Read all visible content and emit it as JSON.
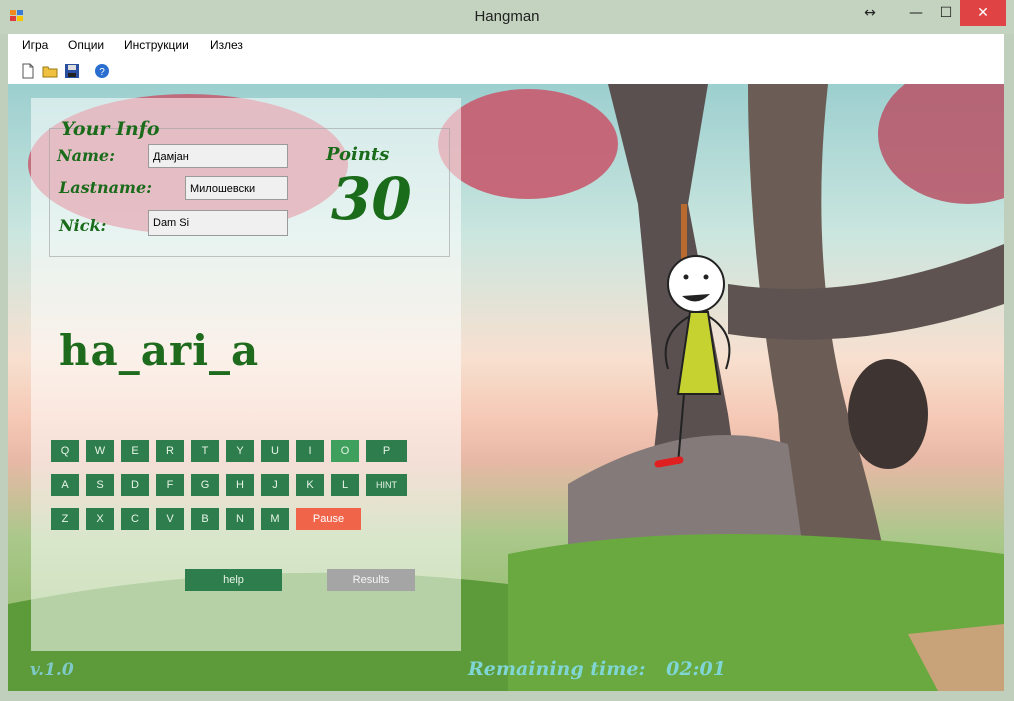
{
  "window": {
    "title": "Hangman",
    "controls": {
      "resize": "↔",
      "minimize": "—",
      "maximize": "☐",
      "close": "✕"
    }
  },
  "menu": [
    "Игра",
    "Опции",
    "Инструкции",
    "Излез"
  ],
  "toolbar": {
    "icons": [
      "new-file-icon",
      "open-folder-icon",
      "save-icon",
      "help-icon"
    ]
  },
  "info": {
    "title": "Your Info",
    "name_label": "Name:",
    "lastname_label": "Lastname:",
    "nick_label": "Nick:",
    "name": "Дамјан",
    "lastname": "Милошевски",
    "nick": "Dam Si"
  },
  "points": {
    "label": "Points",
    "value": "30"
  },
  "word": "ha_ari_a",
  "keyboard": {
    "row1": [
      "Q",
      "W",
      "E",
      "R",
      "T",
      "Y",
      "U",
      "I",
      "O",
      "P"
    ],
    "row2": [
      "A",
      "S",
      "D",
      "F",
      "G",
      "H",
      "J",
      "K",
      "L",
      "HINT"
    ],
    "row3": [
      "Z",
      "X",
      "C",
      "V",
      "B",
      "N",
      "M"
    ],
    "pause": "Pause",
    "active_key": "O"
  },
  "buttons": {
    "help": "help",
    "results": "Results"
  },
  "footer": {
    "version": "v.1.0",
    "timer_label": "Remaining time:",
    "timer_value": "02:01"
  },
  "colors": {
    "accent": "#2e7d4c",
    "pause": "#f0644a",
    "text_green": "#1a6b1a",
    "teal": "#7fd6d4"
  }
}
